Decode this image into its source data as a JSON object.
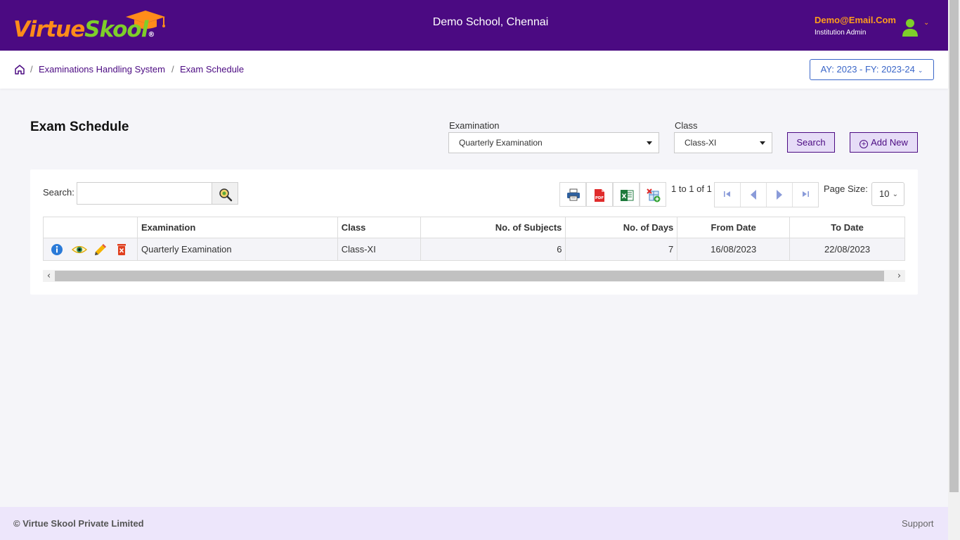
{
  "header": {
    "logo": {
      "part1": "Virtue",
      "part2": "Skool",
      "registered": "®"
    },
    "school_name": "Demo School, Chennai",
    "user_email": "Demo@Email.Com",
    "user_role": "Institution Admin"
  },
  "breadcrumb": {
    "items": [
      "Examinations Handling System",
      "Exam Schedule"
    ],
    "separator": "/"
  },
  "academic_year": {
    "label": "AY: 2023 - FY: 2023-24"
  },
  "page": {
    "title": "Exam Schedule"
  },
  "filters": {
    "examination": {
      "label": "Examination",
      "value": "Quarterly Examination"
    },
    "class": {
      "label": "Class",
      "value": "Class-XI"
    },
    "search_button": "Search",
    "add_new_button": "Add New"
  },
  "grid": {
    "search_label": "Search:",
    "search_value": "",
    "range_text": "1 to 1 of 1",
    "page_size_label": "Page Size:",
    "page_size": "10",
    "columns": [
      "Examination",
      "Class",
      "No. of Subjects",
      "No. of Days",
      "From Date",
      "To Date"
    ],
    "rows": [
      {
        "examination": "Quarterly Examination",
        "class": "Class-XI",
        "subjects": "6",
        "days": "7",
        "from_date": "16/08/2023",
        "to_date": "22/08/2023"
      }
    ]
  },
  "icons": {
    "toolbar": [
      "printer-icon",
      "pdf-icon",
      "excel-icon",
      "export-columns-icon"
    ],
    "row_actions": [
      "info-icon",
      "view-icon",
      "edit-icon",
      "delete-icon"
    ]
  },
  "colors": {
    "brand_purple": "#4b0a82",
    "brand_orange": "#ff8c1a",
    "brand_green": "#7ecf2a",
    "link_blue": "#3a66c8",
    "button_bg": "#e6dcf7"
  },
  "footer": {
    "copyright": "© Virtue Skool Private Limited",
    "support": "Support"
  }
}
